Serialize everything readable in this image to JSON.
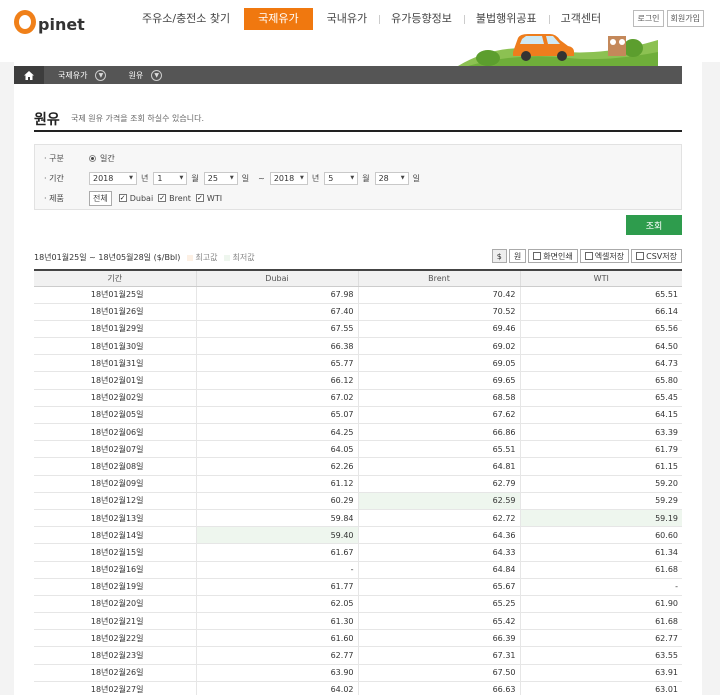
{
  "header": {
    "logo_text": "pinet",
    "nav": [
      "주유소/충전소 찾기",
      "국제유가",
      "국내유가",
      "유가등향정보",
      "불법행위공표",
      "고객센터"
    ],
    "active_nav": 1,
    "login_label": "로그인",
    "signup_label": "회원가입"
  },
  "breadcrumb": {
    "home_icon": "home-icon",
    "items": [
      "국제유가",
      "원유"
    ]
  },
  "page": {
    "title": "원유",
    "description": "국제 원유 가격을 조회 하실수 있습니다."
  },
  "search": {
    "type_label": "구분",
    "type_value": "일간",
    "period_label": "기간",
    "from": {
      "year": "2018",
      "month": "1",
      "day": "25"
    },
    "to": {
      "year": "2018",
      "month": "5",
      "day": "28"
    },
    "unit_year": "년",
    "unit_month": "월",
    "unit_day": "일",
    "tilde": "~",
    "product_label": "제품",
    "all_label": "전체",
    "products": [
      "Dubai",
      "Brent",
      "WTI"
    ],
    "search_button": "조회"
  },
  "summary": {
    "range_text": "18년01월25일 ~ 18년05월28일 ($/Bbl)",
    "legend_high": "최고값",
    "legend_low": "최저값",
    "legend_high_color": "#fdf0e4",
    "legend_low_color": "#eef6ee"
  },
  "tools": {
    "dollar": "$",
    "won": "원",
    "print": "화면인쇄",
    "excel": "엑셀저장",
    "csv": "CSV저장"
  },
  "table": {
    "columns": [
      "기간",
      "Dubai",
      "Brent",
      "WTI"
    ],
    "rows": [
      [
        "18년01월25일",
        "67.98",
        "70.42",
        "65.51"
      ],
      [
        "18년01월26일",
        "67.40",
        "70.52",
        "66.14"
      ],
      [
        "18년01월29일",
        "67.55",
        "69.46",
        "65.56"
      ],
      [
        "18년01월30일",
        "66.38",
        "69.02",
        "64.50"
      ],
      [
        "18년01월31일",
        "65.77",
        "69.05",
        "64.73"
      ],
      [
        "18년02월01일",
        "66.12",
        "69.65",
        "65.80"
      ],
      [
        "18년02월02일",
        "67.02",
        "68.58",
        "65.45"
      ],
      [
        "18년02월05일",
        "65.07",
        "67.62",
        "64.15"
      ],
      [
        "18년02월06일",
        "64.25",
        "66.86",
        "63.39"
      ],
      [
        "18년02월07일",
        "64.05",
        "65.51",
        "61.79"
      ],
      [
        "18년02월08일",
        "62.26",
        "64.81",
        "61.15"
      ],
      [
        "18년02월09일",
        "61.12",
        "62.79",
        "59.20"
      ],
      [
        "18년02월12일",
        "60.29",
        "62.59",
        "59.29"
      ],
      [
        "18년02월13일",
        "59.84",
        "62.72",
        "59.19"
      ],
      [
        "18년02월14일",
        "59.40",
        "64.36",
        "60.60"
      ],
      [
        "18년02월15일",
        "61.67",
        "64.33",
        "61.34"
      ],
      [
        "18년02월16일",
        "-",
        "64.84",
        "61.68"
      ],
      [
        "18년02월19일",
        "61.77",
        "65.67",
        "-"
      ],
      [
        "18년02월20일",
        "62.05",
        "65.25",
        "61.90"
      ],
      [
        "18년02월21일",
        "61.30",
        "65.42",
        "61.68"
      ],
      [
        "18년02월22일",
        "61.60",
        "66.39",
        "62.77"
      ],
      [
        "18년02월23일",
        "62.77",
        "67.31",
        "63.55"
      ],
      [
        "18년02월26일",
        "63.90",
        "67.50",
        "63.91"
      ],
      [
        "18년02월27일",
        "64.02",
        "66.63",
        "63.01"
      ]
    ],
    "low_cells": [
      [
        12,
        2
      ],
      [
        13,
        3
      ],
      [
        14,
        1
      ]
    ]
  }
}
